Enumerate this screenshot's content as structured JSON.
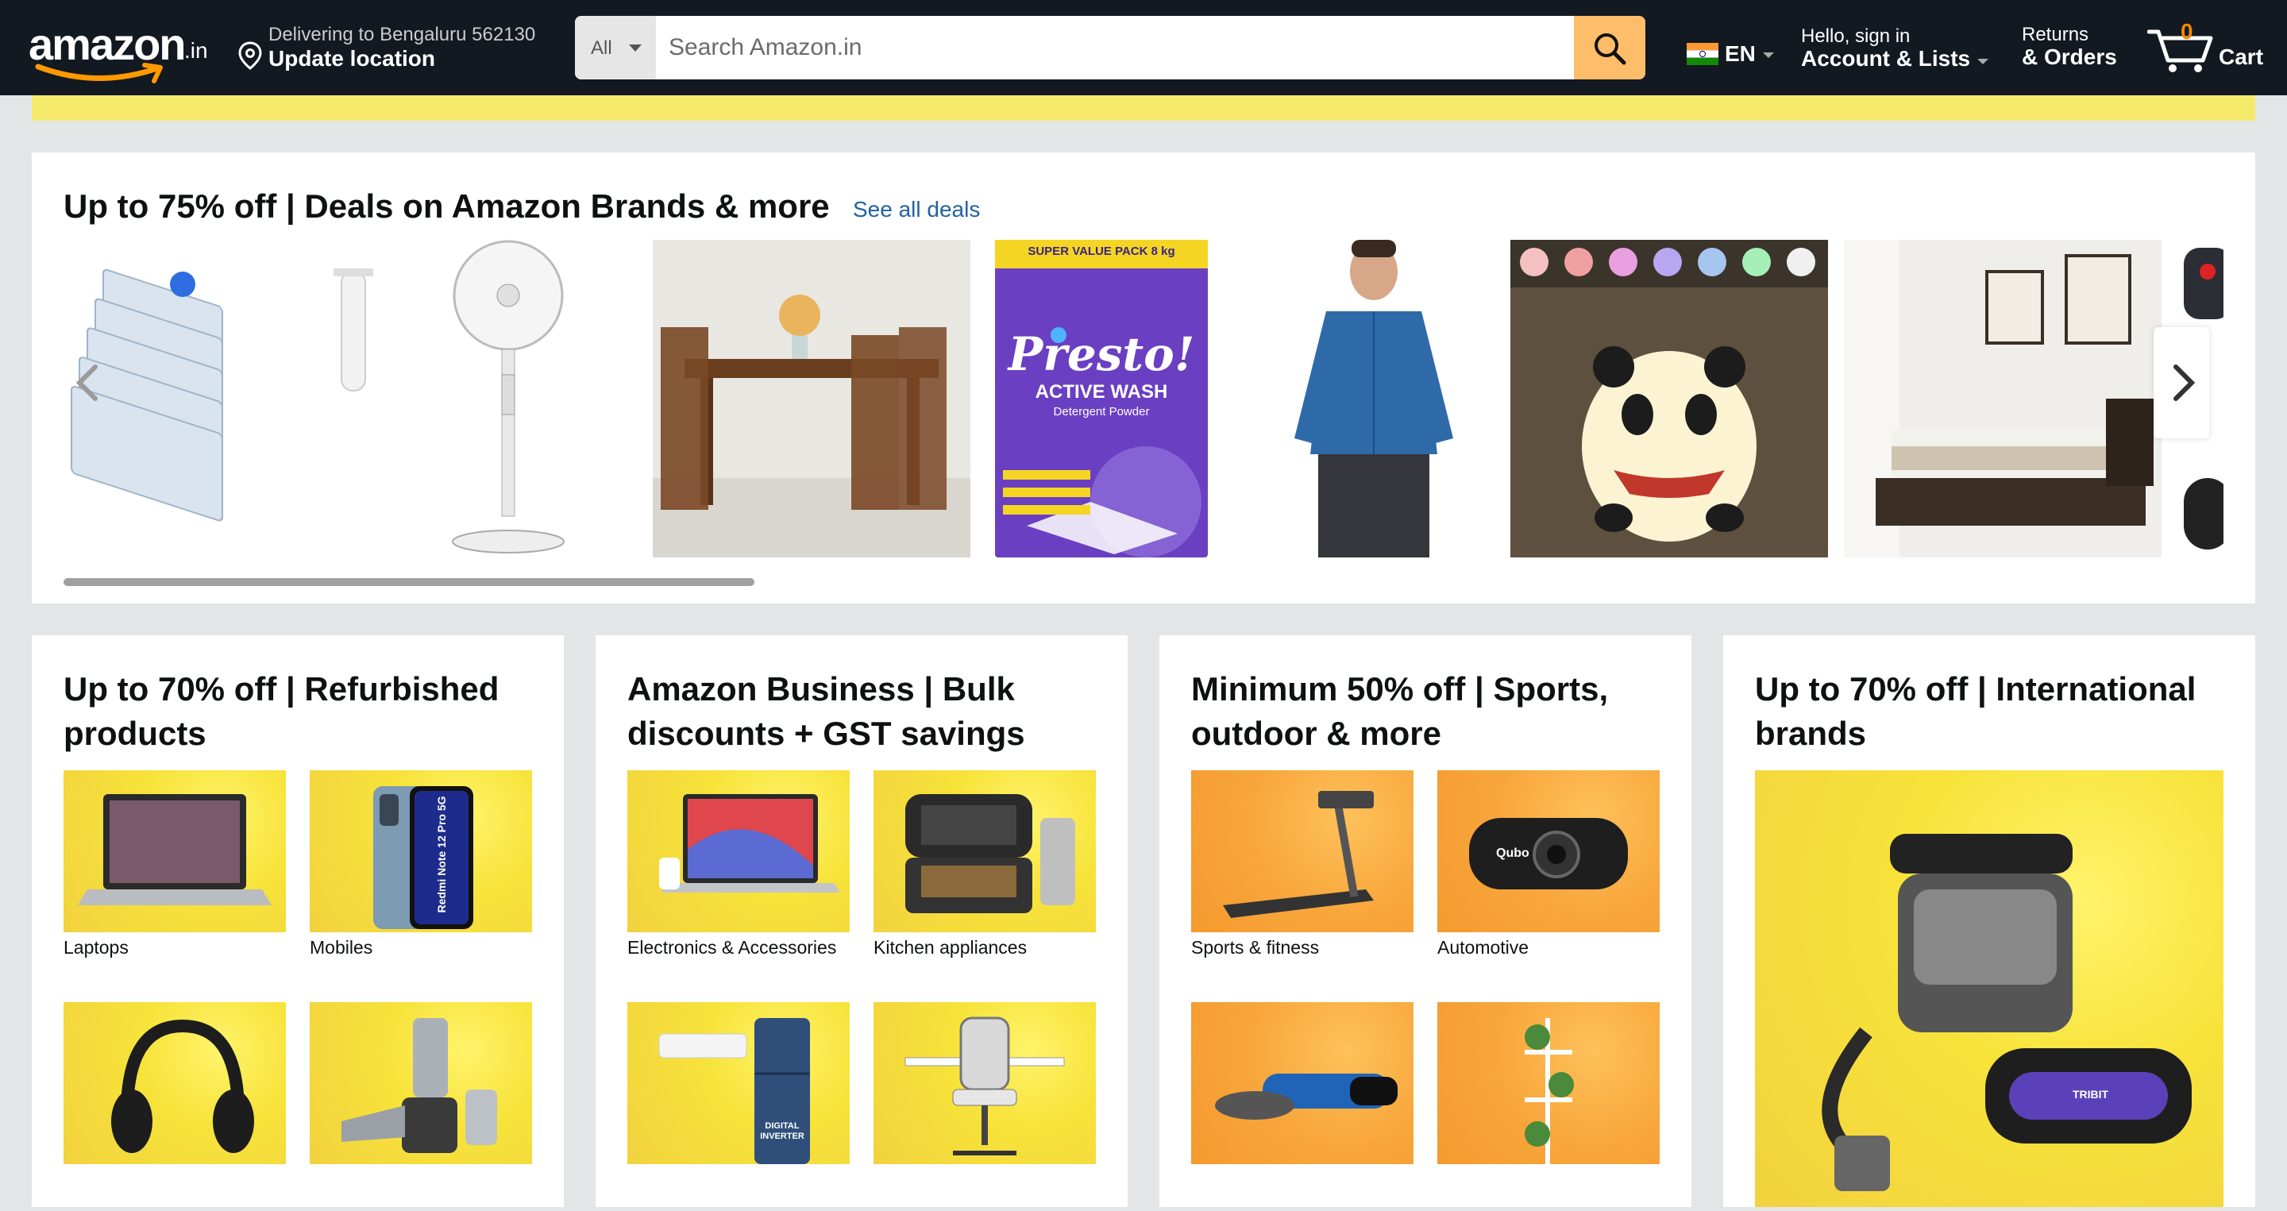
{
  "header": {
    "logo_text": "amazon",
    "logo_suffix": ".in",
    "deliver_line1": "Delivering to Bengaluru 562130",
    "deliver_line2": "Update location",
    "search_category": "All",
    "search_placeholder": "Search Amazon.in",
    "language": "EN",
    "account_line1": "Hello, sign in",
    "account_line2": "Account & Lists",
    "returns_line1": "Returns",
    "returns_line2": "& Orders",
    "cart_count": "0",
    "cart_label": "Cart"
  },
  "deals": {
    "title": "Up to 75% off | Deals on Amazon Brands & more",
    "see_all": "See all deals",
    "products": [
      {
        "icon": "vacuum-storage-bags"
      },
      {
        "icon": "pedestal-fan"
      },
      {
        "icon": "dining-table-set"
      },
      {
        "icon": "detergent-pack",
        "brand": "Presto!",
        "line1": "ACTIVE WASH",
        "line2": "Detergent Powder",
        "badge": "SUPER VALUE PACK 8 kg"
      },
      {
        "icon": "denim-shirt"
      },
      {
        "icon": "panda-night-lamp"
      },
      {
        "icon": "bedroom-bed"
      },
      {
        "icon": "rc-car"
      }
    ],
    "scroll_position": 0.32
  },
  "cards": [
    {
      "title": "Up to 70% off | Refurbished products",
      "tiles": [
        {
          "label": "Laptops",
          "icon": "laptop"
        },
        {
          "label": "Mobiles",
          "icon": "mobile-phone",
          "phone_text": "Redmi Note 12 Pro 5G"
        },
        {
          "label": "",
          "icon": "headphones"
        },
        {
          "label": "",
          "icon": "mixer-grinder"
        }
      ]
    },
    {
      "title": "Amazon Business | Bulk discounts + GST savings",
      "tiles": [
        {
          "label": "Electronics & Accessories",
          "icon": "macbook"
        },
        {
          "label": "Kitchen appliances",
          "icon": "sandwich-maker"
        },
        {
          "label": "",
          "icon": "air-conditioner-refrigerator",
          "fridge_text": "DIGITAL INVERTER"
        },
        {
          "label": "",
          "icon": "office-chair"
        }
      ]
    },
    {
      "title": "Minimum 50% off | Sports, outdoor & more",
      "tiles": [
        {
          "label": "Sports & fitness",
          "icon": "treadmill"
        },
        {
          "label": "Automotive",
          "icon": "dash-camera",
          "cam_brand": "Qubo"
        },
        {
          "label": "",
          "icon": "angle-grinder"
        },
        {
          "label": "",
          "icon": "plant-stand"
        }
      ]
    },
    {
      "title": "Up to 70% off | International brands",
      "feature_icon": "wet-dry-vacuum-and-speaker",
      "speaker_brand": "TRIBIT"
    }
  ],
  "colors": {
    "header_bg": "#131921",
    "search_button": "#febd69",
    "link": "#2162a1",
    "cart_count": "#f08804",
    "strip": "#f4e96a"
  }
}
